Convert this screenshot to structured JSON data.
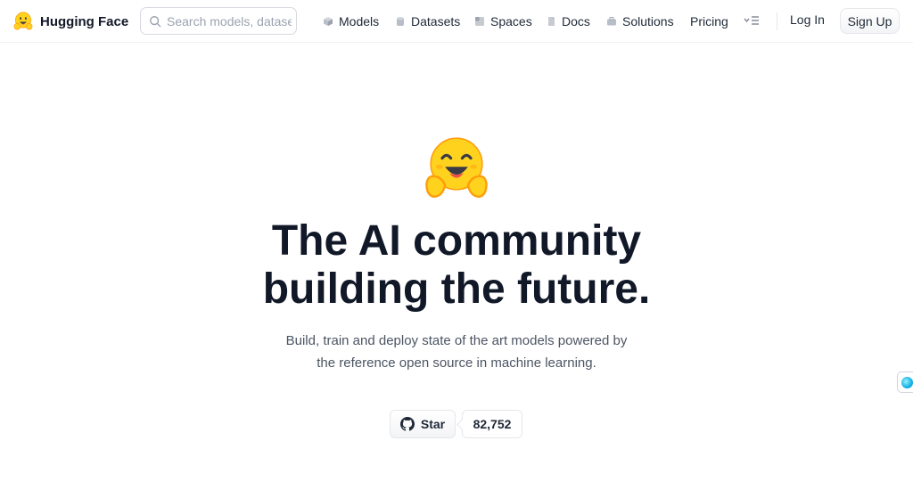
{
  "brand": {
    "name": "Hugging Face",
    "logo": "hugging-face-emoji"
  },
  "search": {
    "placeholder": "Search models, datasets, users...",
    "value": ""
  },
  "nav": {
    "items": [
      {
        "label": "Models",
        "icon": "cube-icon"
      },
      {
        "label": "Datasets",
        "icon": "database-icon"
      },
      {
        "label": "Spaces",
        "icon": "grid-icon"
      },
      {
        "label": "Docs",
        "icon": "book-icon"
      },
      {
        "label": "Solutions",
        "icon": "briefcase-icon"
      },
      {
        "label": "Pricing",
        "icon": ""
      }
    ],
    "more_icon": "more-menu-icon",
    "login_label": "Log In",
    "signup_label": "Sign Up"
  },
  "hero": {
    "emoji": "hugging-face-emoji",
    "title_line1": "The AI community",
    "title_line2": "building the future.",
    "subtitle_line1": "Build, train and deploy state of the art models powered by",
    "subtitle_line2": "the reference open source in machine learning."
  },
  "github": {
    "star_label": "Star",
    "star_count": "82,752",
    "icon": "github-icon"
  },
  "colors": {
    "text": "#111827",
    "muted": "#4b5563",
    "border": "#e5e7eb",
    "emoji_yellow": "#ffd21e",
    "emoji_orange": "#ff9d0b"
  }
}
